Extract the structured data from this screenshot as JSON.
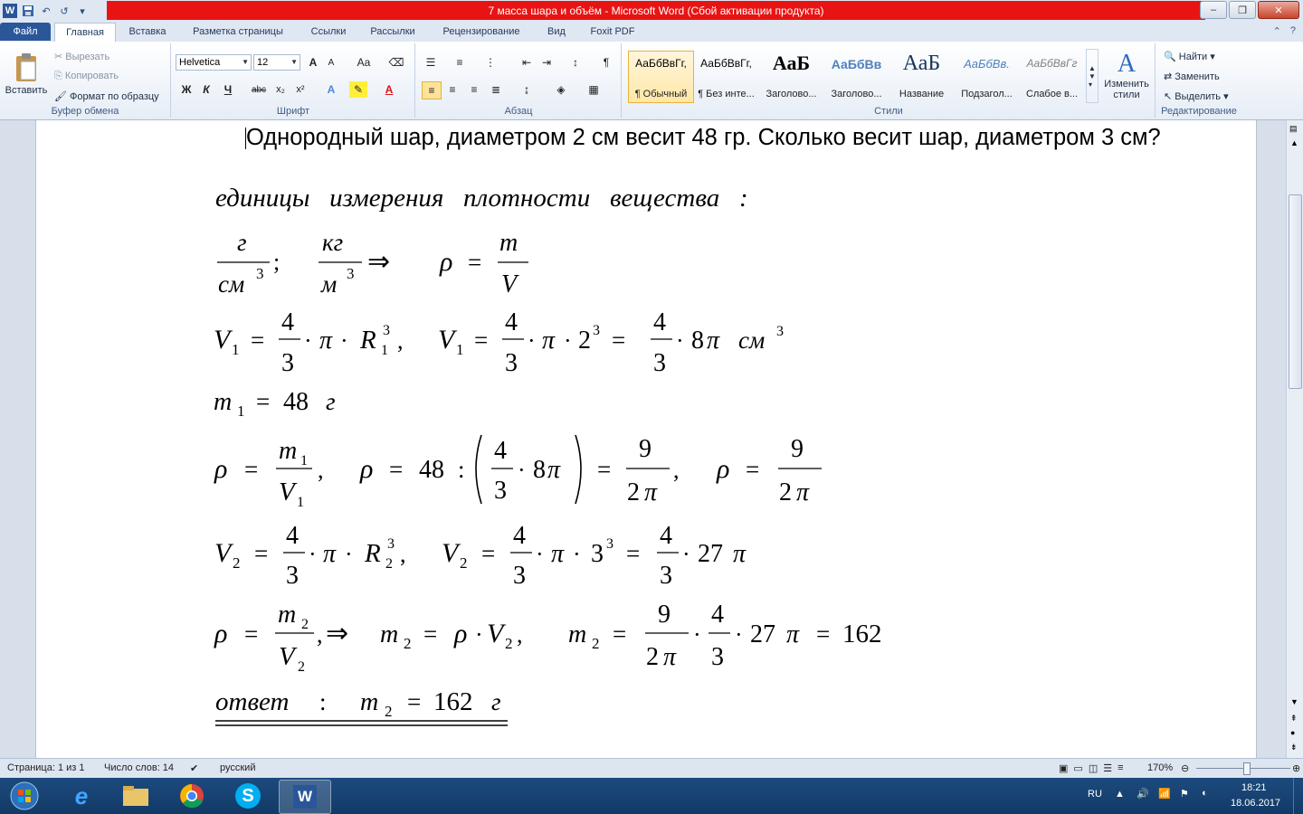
{
  "window": {
    "title": "7 масса шара и объём  -  Microsoft Word (Сбой активации продукта)",
    "controls": {
      "minimize": "–",
      "maximize": "❐",
      "close": "✕"
    }
  },
  "quick_access": {
    "undo": "↶",
    "redo": "↺"
  },
  "tabs": [
    "Файл",
    "Главная",
    "Вставка",
    "Разметка страницы",
    "Ссылки",
    "Рассылки",
    "Рецензирование",
    "Вид",
    "Foxit PDF"
  ],
  "clipboard": {
    "paste": "Вставить",
    "cut": "Вырезать",
    "copy": "Копировать",
    "format_painter": "Формат по образцу",
    "group": "Буфер обмена"
  },
  "font": {
    "name": "Helvetica",
    "size": "12",
    "group": "Шрифт",
    "grow": "A",
    "shrink": "A",
    "case": "Aa",
    "bold": "Ж",
    "italic": "К",
    "underline": "Ч",
    "strike": "abc",
    "sub": "x₂",
    "sup": "x²"
  },
  "paragraph": {
    "group": "Абзац",
    "pilcrow": "¶"
  },
  "styles": {
    "group": "Стили",
    "items": [
      {
        "sample": "АаБбВвГг,",
        "name": "¶ Обычный"
      },
      {
        "sample": "АаБбВвГг,",
        "name": "¶ Без инте..."
      },
      {
        "sample": "АаБ",
        "name": "Заголово..."
      },
      {
        "sample": "АаБбВв",
        "name": "Заголово..."
      },
      {
        "sample": "АаБ",
        "name": "Название"
      },
      {
        "sample": "АаБбВв.",
        "name": "Подзагол..."
      },
      {
        "sample": "АаБбВвГг",
        "name": "Слабое в..."
      }
    ],
    "change_line1": "Изменить",
    "change_line2": "стили"
  },
  "editing": {
    "group": "Редактирование",
    "find": "Найти",
    "replace": "Заменить",
    "select": "Выделить"
  },
  "document": {
    "question": "Однородный шар, диаметром 2 см весит 48 гр. Сколько весит шар, диаметром 3 см?",
    "math": {
      "l1": "единицы   измерения   плотности   вещества   :",
      "g": "г",
      "cm": "см",
      "kg": "кг",
      "m": "м",
      "three": "3",
      "semi": ";",
      "implies": "⇒",
      "rho": "ρ",
      "eq": "=",
      "mvar": "m",
      "Vvar": "V",
      "V": "V",
      "one": "1",
      "two": "2",
      "four": "4",
      "dot": "·",
      "pi": "π",
      "R": "R",
      "comma": ",",
      "eight": "8",
      "cm3": "см",
      "m1_val": "48",
      "m1_unit": "г",
      "colon": ":",
      "nine": "9",
      "twentyseven": "27",
      "result": "162",
      "answer": "ответ",
      "ans_colon": ":",
      "ans_val": "162",
      "ans_unit": "г"
    }
  },
  "status": {
    "page": "Страница: 1 из 1",
    "words": "Число слов: 14",
    "lang": "русский",
    "zoom": "170%"
  },
  "tray": {
    "lang": "RU",
    "time": "18:21",
    "date": "18.06.2017"
  }
}
